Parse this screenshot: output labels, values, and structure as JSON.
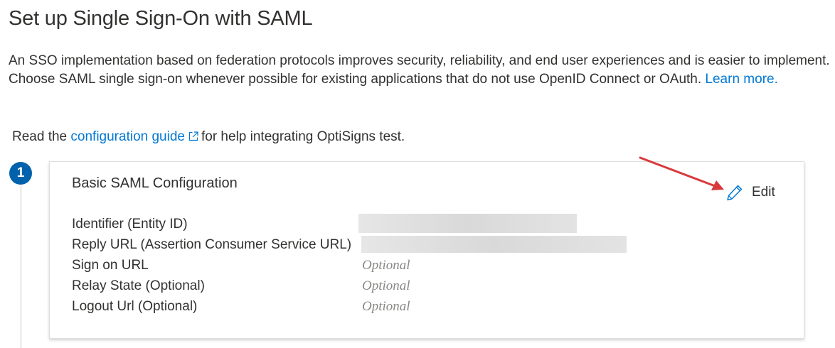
{
  "page": {
    "title": "Set up Single Sign-On with SAML",
    "intro_text": "An SSO implementation based on federation protocols improves security, reliability, and end user experiences and is easier to implement. Choose SAML single sign-on whenever possible for existing applications that do not use OpenID Connect or OAuth.",
    "learn_more_label": "Learn more.",
    "guide_prefix": "Read the",
    "guide_link_label": "configuration guide",
    "guide_suffix": "for help integrating OptiSigns test."
  },
  "step": {
    "number": "1"
  },
  "card": {
    "title": "Basic SAML Configuration",
    "edit_label": "Edit",
    "rows": [
      {
        "label": "Identifier (Entity ID)",
        "value": "",
        "redacted": true
      },
      {
        "label": "Reply URL (Assertion Consumer Service URL)",
        "value": "",
        "redacted": true
      },
      {
        "label": "Sign on URL",
        "value": "Optional",
        "redacted": false
      },
      {
        "label": "Relay State (Optional)",
        "value": "Optional",
        "redacted": false
      },
      {
        "label": "Logout Url (Optional)",
        "value": "Optional",
        "redacted": false
      }
    ]
  },
  "colors": {
    "link": "#0078d4",
    "badge": "#0062ad",
    "annotation_arrow": "#d9393c",
    "placeholder_text": "#8a8886"
  },
  "icons": {
    "external_link": "external-link-icon",
    "edit": "pencil-icon",
    "annotation": "red-arrow-annotation"
  }
}
